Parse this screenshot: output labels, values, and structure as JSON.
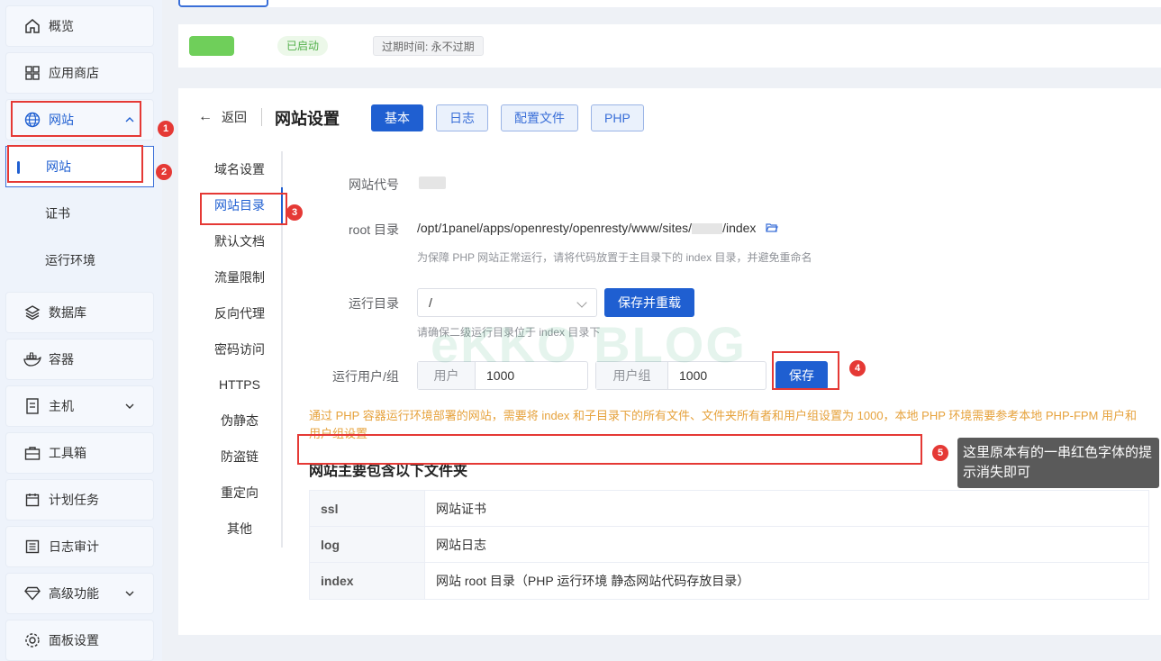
{
  "sidebar": {
    "items": [
      {
        "label": "概览",
        "icon": "home-icon"
      },
      {
        "label": "应用商店",
        "icon": "grid-icon"
      },
      {
        "label": "网站",
        "icon": "globe-icon"
      },
      {
        "label": "网站"
      },
      {
        "label": "证书"
      },
      {
        "label": "运行环境"
      },
      {
        "label": "数据库",
        "icon": "layers-icon"
      },
      {
        "label": "容器",
        "icon": "docker-icon"
      },
      {
        "label": "主机",
        "icon": "server-icon"
      },
      {
        "label": "工具箱",
        "icon": "toolbox-icon"
      },
      {
        "label": "计划任务",
        "icon": "calendar-icon"
      },
      {
        "label": "日志审计",
        "icon": "log-icon"
      },
      {
        "label": "高级功能",
        "icon": "diamond-icon"
      },
      {
        "label": "面板设置",
        "icon": "gear-icon"
      }
    ]
  },
  "status": {
    "running": "已启动",
    "expire": "过期时间: 永不过期"
  },
  "header": {
    "back": "返回",
    "title": "网站设置",
    "tabs": [
      "基本",
      "日志",
      "配置文件",
      "PHP"
    ]
  },
  "subnav": [
    "域名设置",
    "网站目录",
    "默认文档",
    "流量限制",
    "反向代理",
    "密码访问",
    "HTTPS",
    "伪静态",
    "防盗链",
    "重定向",
    "其他"
  ],
  "form": {
    "site_code_label": "网站代号",
    "root_label": "root 目录",
    "root_path_prefix": "/opt/1panel/apps/openresty/openresty/www/sites/",
    "root_path_suffix": "/index",
    "root_hint": "为保障 PHP 网站正常运行，请将代码放置于主目录下的 index 目录，并避免重命名",
    "run_dir_label": "运行目录",
    "run_dir_value": "/",
    "save_reload": "保存并重载",
    "run_dir_hint": "请确保二级运行目录位于 index 目录下",
    "run_user_label": "运行用户/组",
    "user_prefix": "用户",
    "user_value": "1000",
    "group_prefix": "用户组",
    "group_value": "1000",
    "save": "保存"
  },
  "warning": "通过 PHP 容器运行环境部署的网站，需要将 index 和子目录下的所有文件、文件夹所有者和用户组设置为 1000，本地 PHP 环境需要参考本地 PHP-FPM 用户和用户组设置",
  "section_title": "网站主要包含以下文件夹",
  "folders": [
    {
      "name": "ssl",
      "desc": "网站证书"
    },
    {
      "name": "log",
      "desc": "网站日志"
    },
    {
      "name": "index",
      "desc": "网站 root 目录（PHP 运行环境 静态网站代码存放目录）"
    }
  ],
  "annotations": {
    "n1": "1",
    "n2": "2",
    "n3": "3",
    "n4": "4",
    "n5": "5",
    "tooltip": "这里原本有的一串红色字体的提示消失即可"
  },
  "watermark": "eKKO BLOG"
}
